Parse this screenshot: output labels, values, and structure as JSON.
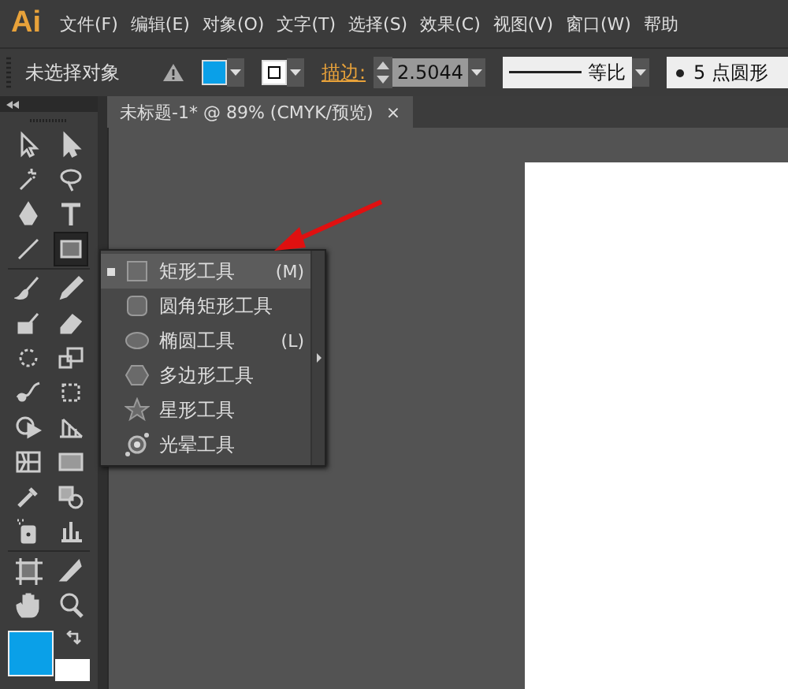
{
  "menu_bar": {
    "logo": "Ai",
    "items": [
      "文件(F)",
      "编辑(E)",
      "对象(O)",
      "文字(T)",
      "选择(S)",
      "效果(C)",
      "视图(V)",
      "窗口(W)",
      "帮助"
    ]
  },
  "control_bar": {
    "selection": "未选择对象",
    "stroke_label": "描边:",
    "stroke_weight": "2.5044",
    "profile": "等比",
    "brush": "5 点圆形"
  },
  "document_tab": {
    "title": "未标题-1* @ 89% (CMYK/预览)",
    "close": "×"
  },
  "tools": [
    {
      "selected": false
    },
    {
      "selected": false
    },
    {
      "selected": false
    },
    {
      "selected": false
    },
    {
      "selected": false
    },
    {
      "selected": false
    },
    {
      "selected": false
    },
    {
      "selected": true
    },
    {
      "selected": false
    },
    {
      "selected": false
    },
    {
      "selected": false
    },
    {
      "selected": false
    },
    {
      "selected": false
    },
    {
      "selected": false
    },
    {
      "selected": false
    },
    {
      "selected": false
    },
    {
      "selected": false
    },
    {
      "selected": false
    },
    {
      "selected": false
    },
    {
      "selected": false
    },
    {
      "selected": false
    },
    {
      "selected": false
    },
    {
      "selected": false
    },
    {
      "selected": false
    },
    {
      "selected": false
    },
    {
      "selected": false
    },
    {
      "selected": false
    },
    {
      "selected": false
    }
  ],
  "flyout": {
    "items": [
      {
        "kind": "rectangle",
        "label": "矩形工具",
        "shortcut": "(M)",
        "selected": true
      },
      {
        "kind": "rounded",
        "label": "圆角矩形工具",
        "selected": false
      },
      {
        "kind": "ellipse",
        "label": "椭圆工具",
        "shortcut": "(L)",
        "selected": false
      },
      {
        "kind": "polygon",
        "label": "多边形工具",
        "selected": false
      },
      {
        "kind": "star",
        "label": "星形工具",
        "selected": false
      },
      {
        "kind": "flare",
        "label": "光晕工具",
        "selected": false
      }
    ]
  }
}
